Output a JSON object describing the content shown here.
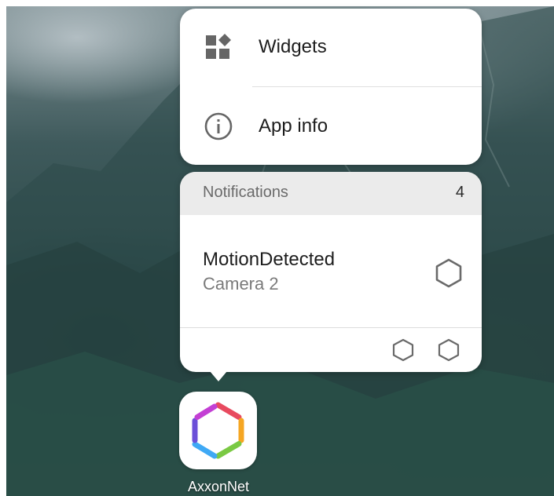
{
  "menu": {
    "items": [
      {
        "label": "Widgets",
        "icon": "widgets-icon"
      },
      {
        "label": "App info",
        "icon": "info-icon"
      }
    ]
  },
  "notifications": {
    "header": "Notifications",
    "count": "4",
    "item": {
      "title": "MotionDetected",
      "subtitle": "Camera 2",
      "icon": "hexagon-icon"
    },
    "actions": [
      "hexagon-action-icon",
      "hexagon-action-icon"
    ]
  },
  "app": {
    "label": "AxxonNet",
    "icon": "axxonnet-logo",
    "logo_colors": [
      "#e84a5f",
      "#f5a623",
      "#7ac943",
      "#3fa9f5",
      "#6b4fd8",
      "#c33fd4"
    ]
  },
  "colors": {
    "card": "#ffffff",
    "header_bg": "#ebebeb",
    "text_primary": "#1d1d1d",
    "text_secondary": "#7a7a7a"
  }
}
